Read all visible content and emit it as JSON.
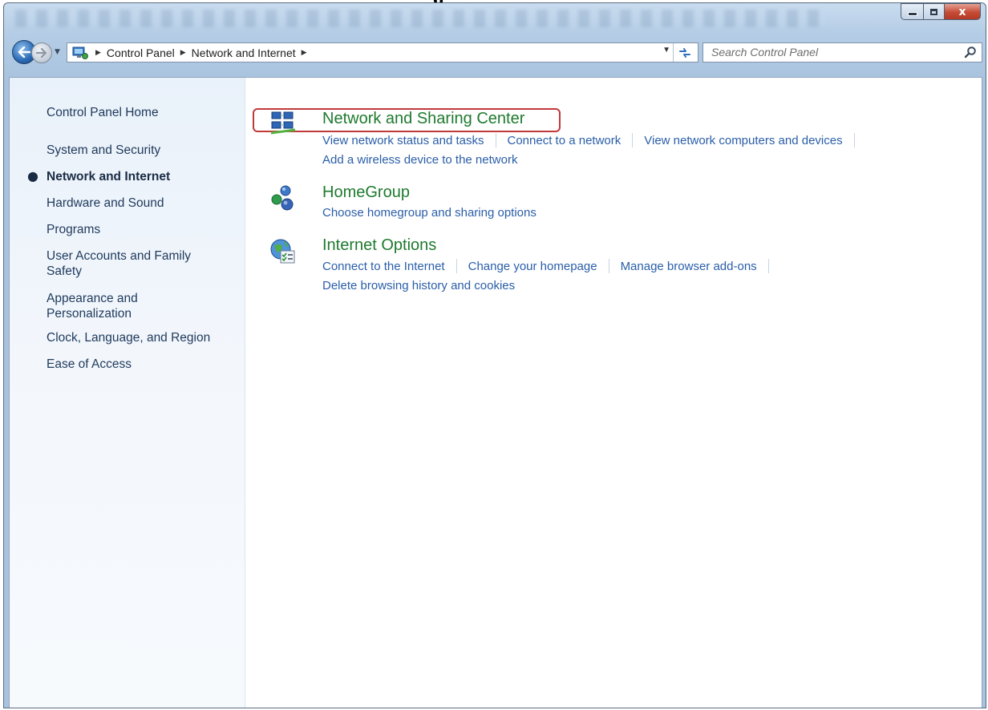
{
  "window": {
    "buttons": {
      "close": "x"
    }
  },
  "address_bar": {
    "breadcrumbs": [
      "Control Panel",
      "Network and Internet"
    ],
    "search_placeholder": "Search Control Panel"
  },
  "sidebar": {
    "items": [
      {
        "label": "Control Panel Home",
        "active": false
      },
      {
        "label": "System and Security",
        "active": false
      },
      {
        "label": "Network and Internet",
        "active": true
      },
      {
        "label": "Hardware and Sound",
        "active": false
      },
      {
        "label": "Programs",
        "active": false
      },
      {
        "label": "User Accounts and Family Safety",
        "active": false
      },
      {
        "label": "Appearance and Personalization",
        "active": false
      },
      {
        "label": "Clock, Language, and Region",
        "active": false
      },
      {
        "label": "Ease of Access",
        "active": false
      }
    ]
  },
  "categories": [
    {
      "title": "Network and Sharing Center",
      "icon": "network-sharing-icon",
      "links": [
        "View network status and tasks",
        "Connect to a network",
        "View network computers and devices",
        "Add a wireless device to the network"
      ]
    },
    {
      "title": "HomeGroup",
      "icon": "homegroup-icon",
      "links": [
        "Choose homegroup and sharing options"
      ]
    },
    {
      "title": "Internet Options",
      "icon": "internet-options-icon",
      "links": [
        "Connect to the Internet",
        "Change your homepage",
        "Manage browser add-ons",
        "Delete browsing history and cookies"
      ]
    }
  ],
  "colors": {
    "link": "#2a5ea8",
    "category_title": "#1e7a2e",
    "highlight_border": "#c0393b"
  }
}
